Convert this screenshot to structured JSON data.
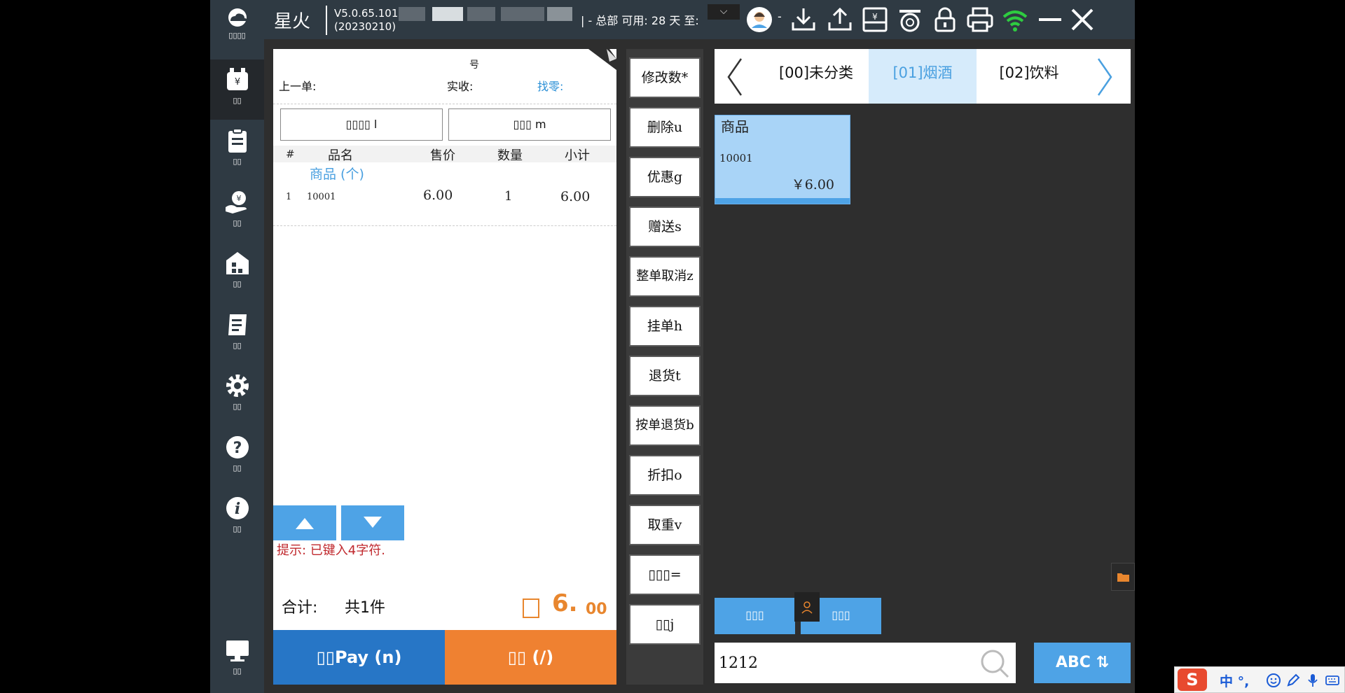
{
  "sidebar": {
    "logo_label": "▯▯▯▯",
    "items": [
      {
        "icon": "cashier-icon",
        "label": "▯▯"
      },
      {
        "icon": "clipboard-icon",
        "label": "▯▯"
      },
      {
        "icon": "money-hand-icon",
        "label": "▯▯"
      },
      {
        "icon": "store-icon",
        "label": "▯▯"
      },
      {
        "icon": "receipt-scroll-icon",
        "label": "▯▯"
      },
      {
        "icon": "gear-icon",
        "label": "▯▯"
      },
      {
        "icon": "help-icon",
        "label": "▯▯"
      },
      {
        "icon": "info-icon",
        "label": "▯▯"
      },
      {
        "icon": "monitor-icon",
        "label": "▯▯"
      }
    ]
  },
  "topbar": {
    "app_name": "星火",
    "version": "V5.0.65.101",
    "build": "(20230210)",
    "store_info": "| - 总部 可用: 28 天 至:",
    "dropdown": "⌵",
    "user_suffix": "-"
  },
  "receipt": {
    "code_fragment": "号",
    "prev_label": "上一单:",
    "paid_label": "实收:",
    "change_label": "找零:",
    "member_button": "▯▯▯▯ l",
    "guide_button": "▯▯▯ m",
    "columns": [
      "#",
      "品名",
      "售价",
      "数量",
      "小计"
    ],
    "items": [
      {
        "name": "商品 (个)",
        "index": "1",
        "code": "10001",
        "price": "6.00",
        "qty": "1",
        "subtotal": "6.00"
      }
    ],
    "hint": "提示: 已键入4字符.",
    "total_label": "合计:",
    "total_count": "共1件",
    "total_integer": "6.",
    "total_decimal": "00",
    "pay_button": "▯▯Pay (n)",
    "cash_button": "▯▯ (/)"
  },
  "functions": [
    "修改数*",
    "删除u",
    "优惠g",
    "赠送s",
    "整单取消z",
    "挂单h",
    "退货t",
    "按单退货b",
    "折扣o",
    "取重v",
    "▯▯▯=",
    "▯▯j"
  ],
  "categories": {
    "tabs": [
      {
        "label": "[00]未分类",
        "active": false
      },
      {
        "label": "[01]烟酒",
        "active": true
      },
      {
        "label": "[02]饮料",
        "active": false
      }
    ]
  },
  "product": {
    "name": "商品",
    "code": "10001",
    "price": "￥6.00"
  },
  "bottom": {
    "btn_left": "▯▯▯",
    "btn_right": "▯▯▯",
    "search_value": "1212",
    "abc_button": "ABC ⇅"
  },
  "ime": {
    "logo": "S",
    "mode": "中 °,"
  },
  "colors": {
    "accent_blue": "#4ea3e6",
    "pay_blue": "#2776c6",
    "cash_orange": "#ef8131",
    "hint_red": "#c0282d",
    "wifi_green": "#2ecc40"
  }
}
